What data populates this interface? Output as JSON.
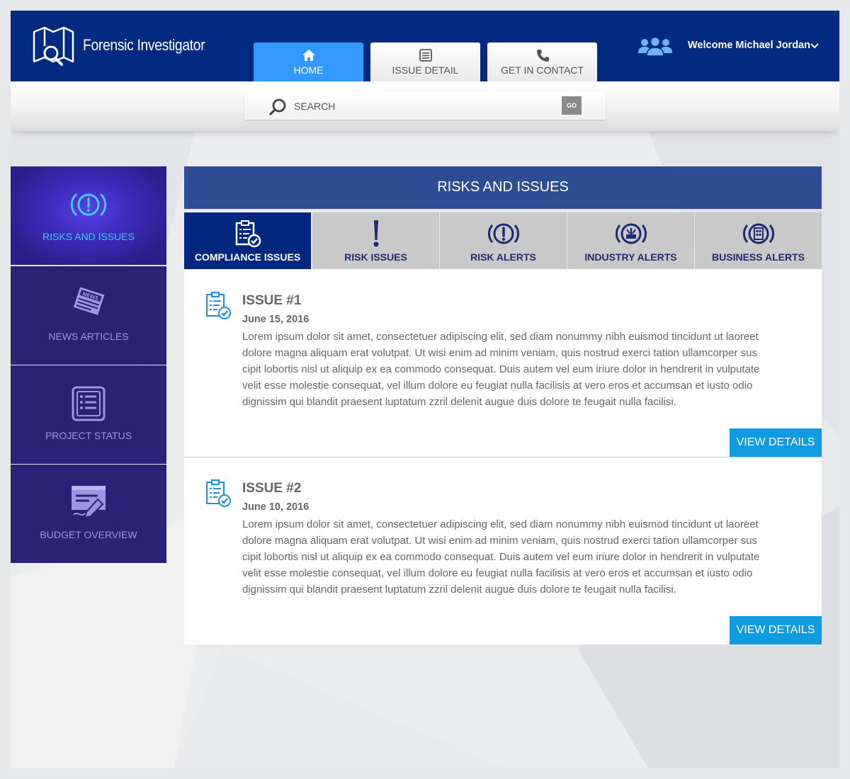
{
  "header": {
    "brand": "Forensic Investigator",
    "welcome": "Welcome Michael Jordan",
    "nav": [
      {
        "label": "HOME",
        "icon": "home-icon",
        "active": true
      },
      {
        "label": "ISSUE DETAIL",
        "icon": "list-icon",
        "active": false
      },
      {
        "label": "GET IN CONTACT",
        "icon": "phone-icon",
        "active": false
      }
    ]
  },
  "search": {
    "placeholder": "SEARCH",
    "go_label": "GO"
  },
  "sidebar": {
    "items": [
      {
        "label": "RISKS AND ISSUES",
        "icon": "alert-circle-icon",
        "active": true
      },
      {
        "label": "NEWS ARTICLES",
        "icon": "newspaper-icon",
        "active": false
      },
      {
        "label": "PROJECT STATUS",
        "icon": "list-doc-icon",
        "active": false
      },
      {
        "label": "BUDGET OVERVIEW",
        "icon": "signature-doc-icon",
        "active": false
      }
    ]
  },
  "main": {
    "title": "RISKS AND ISSUES",
    "tabs": [
      {
        "label": "COMPLIANCE ISSUES",
        "icon": "clipboard-check-icon",
        "active": true
      },
      {
        "label": "RISK ISSUES",
        "icon": "exclamation-icon",
        "active": false
      },
      {
        "label": "RISK ALERTS",
        "icon": "alert-circle-icon",
        "active": false
      },
      {
        "label": "INDUSTRY ALERTS",
        "icon": "industry-icon",
        "active": false
      },
      {
        "label": "BUSINESS ALERTS",
        "icon": "building-icon",
        "active": false
      }
    ],
    "issues": [
      {
        "title": "ISSUE #1",
        "date": "June 15, 2016",
        "body_lines": [
          "Lorem ipsum dolor sit amet, consectetuer adipiscing elit, sed diam nonummy nibh euismod tincidunt ut laoreet",
          "dolore magna aliquam erat volutpat. Ut wisi enim ad minim veniam, quis nostrud exerci tation ullamcorper sus",
          "cipit lobortis nisl ut aliquip ex ea commodo consequat. Duis autem vel eum iriure dolor in hendrerit in vulputate",
          "velit esse molestie consequat, vel illum dolore eu feugiat nulla facilisis at vero eros et accumsan et iusto odio",
          "dignissim qui blandit praesent luptatum zzril delenit augue duis dolore te feugait nulla facilisi."
        ],
        "button": "VIEW DETAILS"
      },
      {
        "title": "ISSUE #2",
        "date": "June 10, 2016",
        "body_lines": [
          "Lorem ipsum dolor sit amet, consectetuer adipiscing elit, sed diam nonummy nibh euismod tincidunt ut laoreet",
          "dolore magna aliquam erat volutpat. Ut wisi enim ad minim veniam, quis nostrud exerci tation ullamcorper sus",
          "cipit lobortis nisl ut aliquip ex ea commodo consequat. Duis autem vel eum iriure dolor in hendrerit in vulputate",
          "velit esse molestie consequat, vel illum dolore eu feugiat nulla facilisis at vero eros et accumsan et iusto odio",
          "dignissim qui blandit praesent luptatum zzril delenit augue duis dolore te feugait nulla facilisi."
        ],
        "button": "VIEW DETAILS"
      }
    ]
  },
  "colors": {
    "header_bg": "#012a80",
    "active_nav": "#3399ff",
    "sidebar_bg": "#2b2278",
    "sidebar_active_text": "#44c8ff",
    "title_bar": "#2e4c93",
    "tab_active": "#01277f",
    "button": "#0f9be0"
  }
}
